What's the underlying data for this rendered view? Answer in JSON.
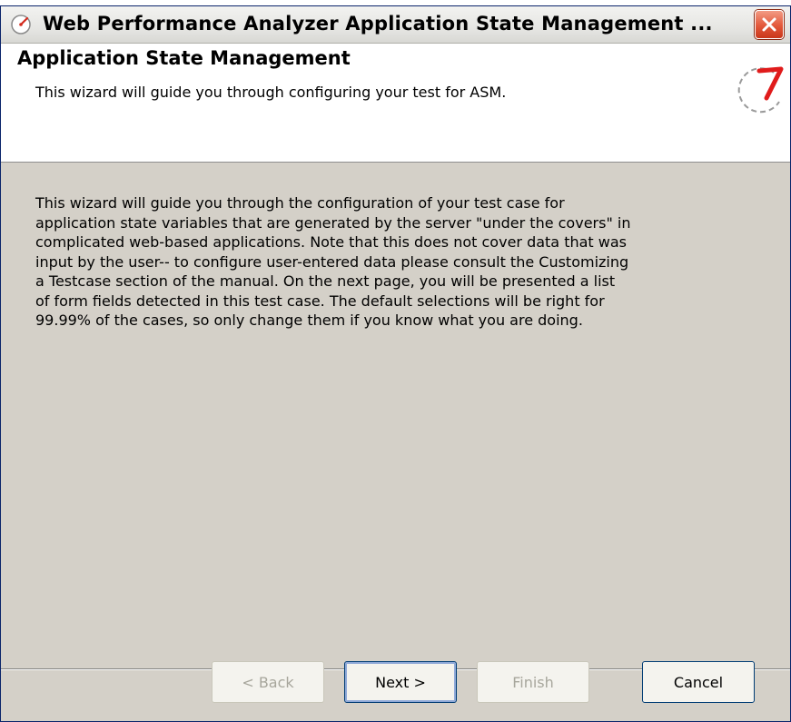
{
  "window": {
    "title": "Web Performance Analyzer Application State Management ..."
  },
  "header": {
    "title": "Application State Management",
    "description": "This wizard will guide you through configuring your test for ASM."
  },
  "body": {
    "lines": [
      "This wizard will guide you through the configuration of your test case for",
      "application state variables that are generated by the server \"under the covers\" in",
      "complicated web-based applications. Note that this does not cover data that was",
      "input by the user-- to configure user-entered data please consult the Customizing",
      "a Testcase section of the manual. On the next page, you will be presented a list",
      "of form fields detected in this test case. The default selections will be right for",
      "99.99% of the cases, so only change them if you know what you are doing."
    ]
  },
  "buttons": {
    "back": "< Back",
    "next": "Next >",
    "finish": "Finish",
    "cancel": "Cancel"
  },
  "colors": {
    "accent": "#e3583a",
    "window_bg": "#d4d0c8"
  },
  "icons": {
    "title": "speedometer-icon",
    "close": "close-icon",
    "header": "speedometer-icon"
  }
}
